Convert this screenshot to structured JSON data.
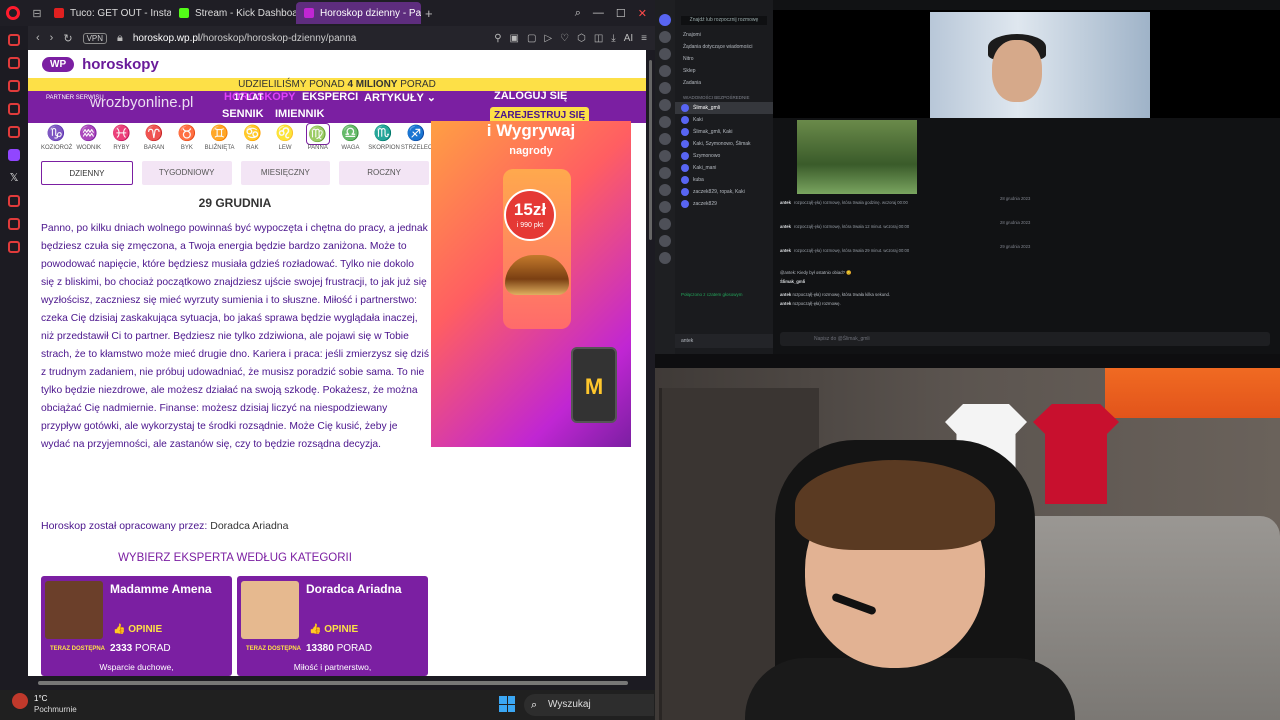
{
  "browser": {
    "tabs": [
      {
        "title": "Tuco: GET OUT - Instant S",
        "color": "#e02020"
      },
      {
        "title": "Stream - Kick Dashboard",
        "color": "#53fc18"
      },
      {
        "title": "Horoskop dzienny - Panna",
        "color": "#7b1fa2",
        "active": true
      }
    ],
    "url_domain": "horoskop.wp.pl",
    "url_path": "/horoskop/horoskop-dzienny/panna",
    "vpn_label": "VPN",
    "ai_label": "AI"
  },
  "site": {
    "wp_badge": "WP",
    "logo": "horoskopy",
    "strip_pre": "UDZIELILIŚMY PONAD ",
    "strip_bold": "4 MILIONY",
    "strip_post": " PORAD",
    "partner": "PARTNER SERWISU",
    "partner_brand": "wrozbyonline.pl",
    "age_badge": "17 LAT",
    "nav": [
      "HOROSKOPY",
      "EKSPERCI",
      "ARTYKUŁY ⌄",
      "SENNIK",
      "IMIENNIK"
    ],
    "login": "ZALOGUJ SIĘ",
    "register": "ZAREJESTRUJ SIĘ",
    "zodiac": [
      {
        "label": "KOZIOROŻ",
        "glyph": "♑"
      },
      {
        "label": "WODNIK",
        "glyph": "♒"
      },
      {
        "label": "RYBY",
        "glyph": "♓"
      },
      {
        "label": "BARAN",
        "glyph": "♈"
      },
      {
        "label": "BYK",
        "glyph": "♉"
      },
      {
        "label": "BLIŹNIĘTA",
        "glyph": "♊"
      },
      {
        "label": "RAK",
        "glyph": "♋"
      },
      {
        "label": "LEW",
        "glyph": "♌"
      },
      {
        "label": "PANNA",
        "glyph": "♍",
        "selected": true
      },
      {
        "label": "WAGA",
        "glyph": "♎"
      },
      {
        "label": "SKORPION",
        "glyph": "♏"
      },
      {
        "label": "STRZELEC",
        "glyph": "♐"
      }
    ],
    "periods": [
      "DZIENNY",
      "TYGODNIOWY",
      "MIESIĘCZNY",
      "ROCZNY"
    ],
    "date": "29 GRUDNIA",
    "horoscope": "Panno, po kilku dniach wolnego powinnaś być wypoczęta i chętna do pracy, a jednak będziesz czuła się zmęczona, a Twoja energia będzie bardzo zaniżona. Może to powodować napięcie, które będziesz musiała gdzieś rozładować. Tylko nie dokolo się z bliskimi, bo chociaż początkowo znajdziesz ujście swojej frustracji, to jak już się wyzłościsz, zaczniesz się mieć wyrzuty sumienia i to słuszne. Miłość i partnerstwo: czeka Cię dzisiaj zaskakująca sytuacja, bo jakaś sprawa będzie wyglądała inaczej, niż przedstawił Ci to partner. Będziesz nie tylko zdziwiona, ale pojawi się w Tobie strach, że to kłamstwo może mieć drugie dno. Kariera i praca: jeśli zmierzysz się dziś z trudnym zadaniem, nie próbuj udowadniać, że musisz poradzić sobie sama. To nie tylko będzie niezdrowe, ale możesz działać na swoją szkodę. Pokażesz, że można obciążać Cię nadmiernie. Finanse: możesz dzisiaj liczyć na niespodziewany przypływ gotówki, ale wykorzystaj te środki rozsądnie. Może Cię kusić, żeby je wydać na przyjemności, ale zastanów się, czy to będzie rozsądna decyzja.",
    "author_label": "Horoskop został opracowany przez: ",
    "author_name": "Doradca Ariadna",
    "experts_title": "WYBIERZ EKSPERTA WEDŁUG KATEGORII",
    "experts": [
      {
        "name": "Madamme Amena",
        "opinie": "👍 OPINIE",
        "avail": "TERAZ DOSTĘPNA",
        "count": "2333",
        "count_label": " PORAD",
        "tagline": "Wsparcie duchowe,",
        "photo_color": "#6b3f2a"
      },
      {
        "name": "Doradca Ariadna",
        "opinie": "👍 OPINIE",
        "avail": "TERAZ DOSTĘPNA",
        "count": "13380",
        "count_label": " PORAD",
        "tagline": "Miłość i partnerstwo,",
        "photo_color": "#e6b98f"
      }
    ],
    "ad": {
      "line1": "i Wygrywaj",
      "line2": "nagrody",
      "price": "15zł",
      "points": "i 990 pkt",
      "logo": "M"
    }
  },
  "taskbar": {
    "temp": "1°C",
    "weather": "Pochmurnie",
    "search": "Wyszukaj"
  },
  "discord": {
    "search": "Znajdź lub rozpocznij rozmowę",
    "channels": [
      "Znajomi",
      "Żądania dotyczące wiadomości",
      "Nitro",
      "Sklep",
      "Zadania"
    ],
    "dm_header": "WIADOMOŚCI BEZPOŚREDNIE",
    "dms": [
      "Ślimak_gmli",
      "Kaki",
      "Ślimak_gmli, Kaki",
      "Kaki, Szymonowo, Ślimak",
      "Szymonowo",
      "Kaki_mani",
      "kuba",
      "zaczek829, ropak, Kaki",
      "zaczek829"
    ],
    "voice_status": "Połączono z czatem głosowym",
    "user": "antek",
    "messages": [
      {
        "user": "antek",
        "text": "rozpoczął(-ęła) rozmowę, która trwała godzinę.",
        "time": "wczoraj 00:00"
      },
      {
        "user": "antek",
        "text": "rozpoczął(-ęła) rozmowę, która trwała 12 minut.",
        "time": "wczoraj 00:00"
      },
      {
        "user": "antek",
        "text": "rozpoczął(-ęła) rozmowę, która trwała 29 minut.",
        "time": "wczoraj 00:00"
      }
    ],
    "days": [
      "28 grudnia 2023",
      "28 grudnia 2023",
      "29 grudnia 2023"
    ],
    "reply_to": "@antek: Kiedy był ostatnio obiad? 😊",
    "reply_user": "Ślimak_gmli",
    "message_after_1": "rozpoczął(-ęła) rozmowę, która trwała kilka sekund.",
    "message_after_2": "rozpoczął(-ęła) rozmowę.",
    "input_placeholder": "Napisz do @Ślimak_gmli"
  }
}
